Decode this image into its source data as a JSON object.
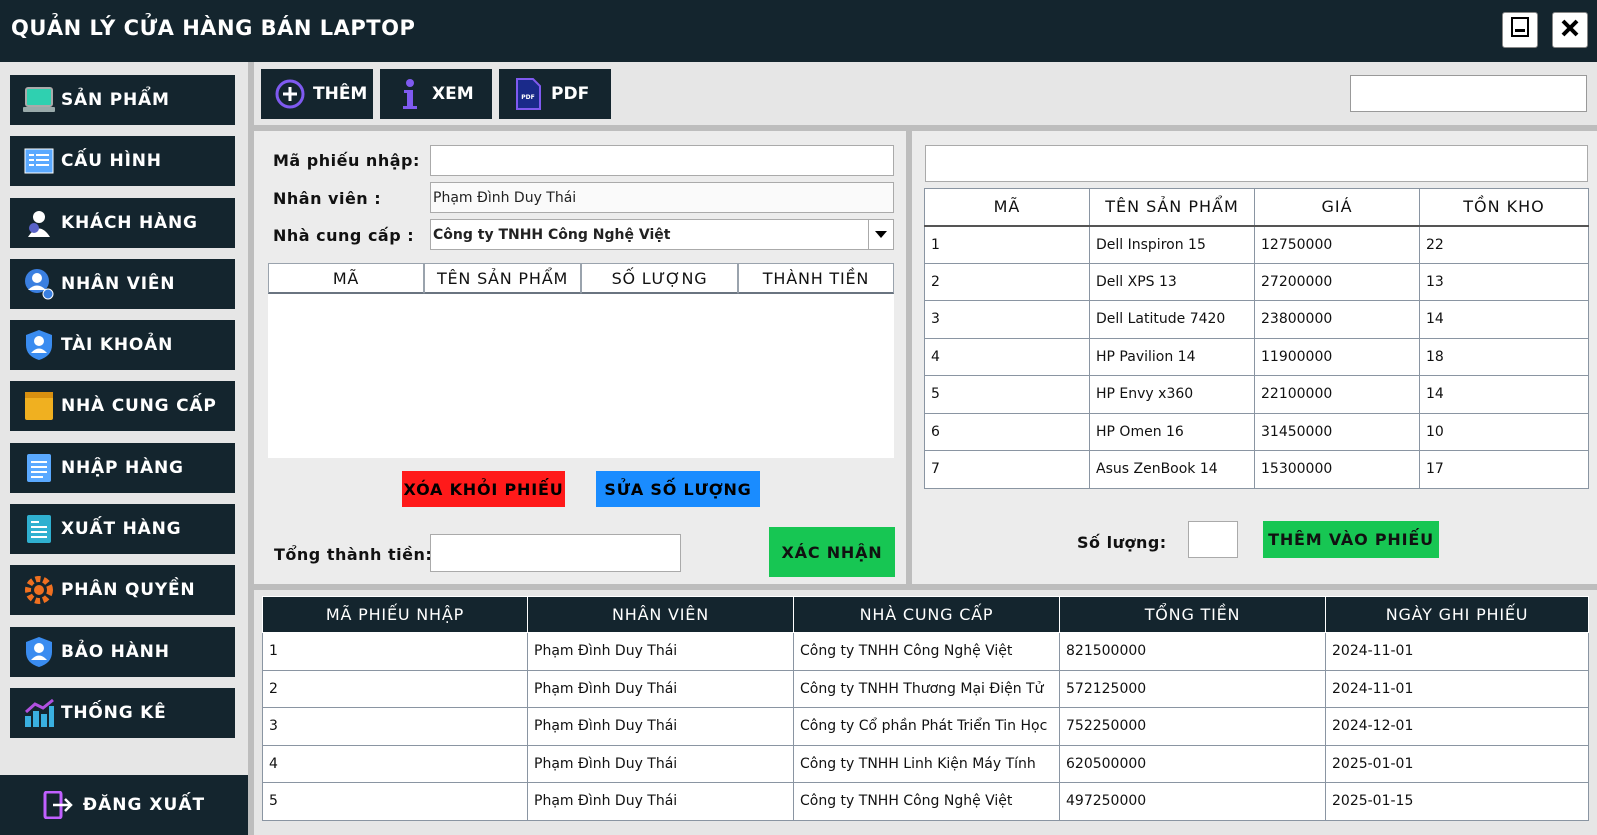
{
  "app": {
    "title": "QUẢN LÝ CỬA HÀNG BÁN LAPTOP",
    "minimize_icon": "minimize-icon",
    "close_icon": "close-icon"
  },
  "sidebar": {
    "items": [
      {
        "label": "SẢN PHẨM",
        "icon": "laptop-icon"
      },
      {
        "label": "CẤU HÌNH",
        "icon": "list-icon"
      },
      {
        "label": "KHÁCH HÀNG",
        "icon": "customer-icon"
      },
      {
        "label": "NHÂN VIÊN",
        "icon": "employee-icon"
      },
      {
        "label": "TÀI KHOẢN",
        "icon": "shield-user-icon"
      },
      {
        "label": "NHÀ CUNG CẤP",
        "icon": "box-icon"
      },
      {
        "label": "NHẬP HÀNG",
        "icon": "notepad-icon"
      },
      {
        "label": "XUẤT HÀNG",
        "icon": "document-icon"
      },
      {
        "label": "PHÂN QUYỀN",
        "icon": "gear-user-icon"
      },
      {
        "label": "BẢO HÀNH",
        "icon": "shield-user-icon"
      },
      {
        "label": "THỐNG KÊ",
        "icon": "chart-icon"
      }
    ],
    "logout_label": "ĐĂNG XUẤT"
  },
  "toolbar": {
    "add_label": "THÊM",
    "view_label": "XEM",
    "pdf_label": "PDF",
    "pdf_icon_text": "PDF",
    "search_value": ""
  },
  "form": {
    "receipt_code_label": "Mã phiếu nhập:",
    "receipt_code_value": "",
    "employee_label": "Nhân viên :",
    "employee_value": "Phạm Đình Duy Thái",
    "supplier_label": "Nhà cung cấp :",
    "supplier_value": "Công ty TNHH Công Nghệ Việt",
    "columns": [
      "MÃ",
      "TÊN SẢN PHẨM",
      "SỐ LƯỢNG",
      "THÀNH TIỀN"
    ],
    "remove_label": "XÓA KHỎI PHIẾU",
    "edit_qty_label": "SỬA SỐ LƯỢNG",
    "total_label": "Tổng thành tiền:",
    "total_value": "",
    "confirm_label": "XÁC NHẬN"
  },
  "products": {
    "search_value": "",
    "columns": [
      "MÃ",
      "TÊN SẢN PHẨM",
      "GIÁ",
      "TỒN KHO"
    ],
    "rows": [
      [
        "1",
        "Dell Inspiron 15",
        "12750000",
        "22"
      ],
      [
        "2",
        "Dell XPS 13",
        "27200000",
        "13"
      ],
      [
        "3",
        "Dell Latitude 7420",
        "23800000",
        "14"
      ],
      [
        "4",
        "HP Pavilion 14",
        "11900000",
        "18"
      ],
      [
        "5",
        "HP Envy x360",
        "22100000",
        "14"
      ],
      [
        "6",
        "HP Omen 16",
        "31450000",
        "10"
      ],
      [
        "7",
        "Asus ZenBook 14",
        "15300000",
        "17"
      ]
    ],
    "qty_label": "Số lượng:",
    "qty_value": "",
    "add_to_receipt_label": "THÊM VÀO PHIẾU"
  },
  "receipts": {
    "columns": [
      "MÃ PHIẾU NHẬP",
      "NHÂN VIÊN",
      "NHÀ CUNG CẤP",
      "TỔNG TIỀN",
      "NGÀY GHI PHIẾU"
    ],
    "rows": [
      [
        "1",
        "Phạm Đình Duy Thái",
        "Công ty TNHH Công Nghệ Việt",
        "821500000",
        "2024-11-01"
      ],
      [
        "2",
        "Phạm Đình Duy Thái",
        "Công ty TNHH Thương Mại Điện Tử",
        "572125000",
        "2024-11-01"
      ],
      [
        "3",
        "Phạm Đình Duy Thái",
        "Công ty Cổ phần Phát Triển Tin Học",
        "752250000",
        "2024-12-01"
      ],
      [
        "4",
        "Phạm Đình Duy Thái",
        "Công ty TNHH Linh Kiện Máy Tính",
        "620500000",
        "2025-01-01"
      ],
      [
        "5",
        "Phạm Đình Duy Thái",
        "Công ty TNHH Công Nghệ Việt",
        "497250000",
        "2025-01-15"
      ]
    ]
  },
  "colors": {
    "dark": "#14252e",
    "red": "#ff1a1a",
    "blue": "#1a8cff",
    "green": "#17c653"
  }
}
